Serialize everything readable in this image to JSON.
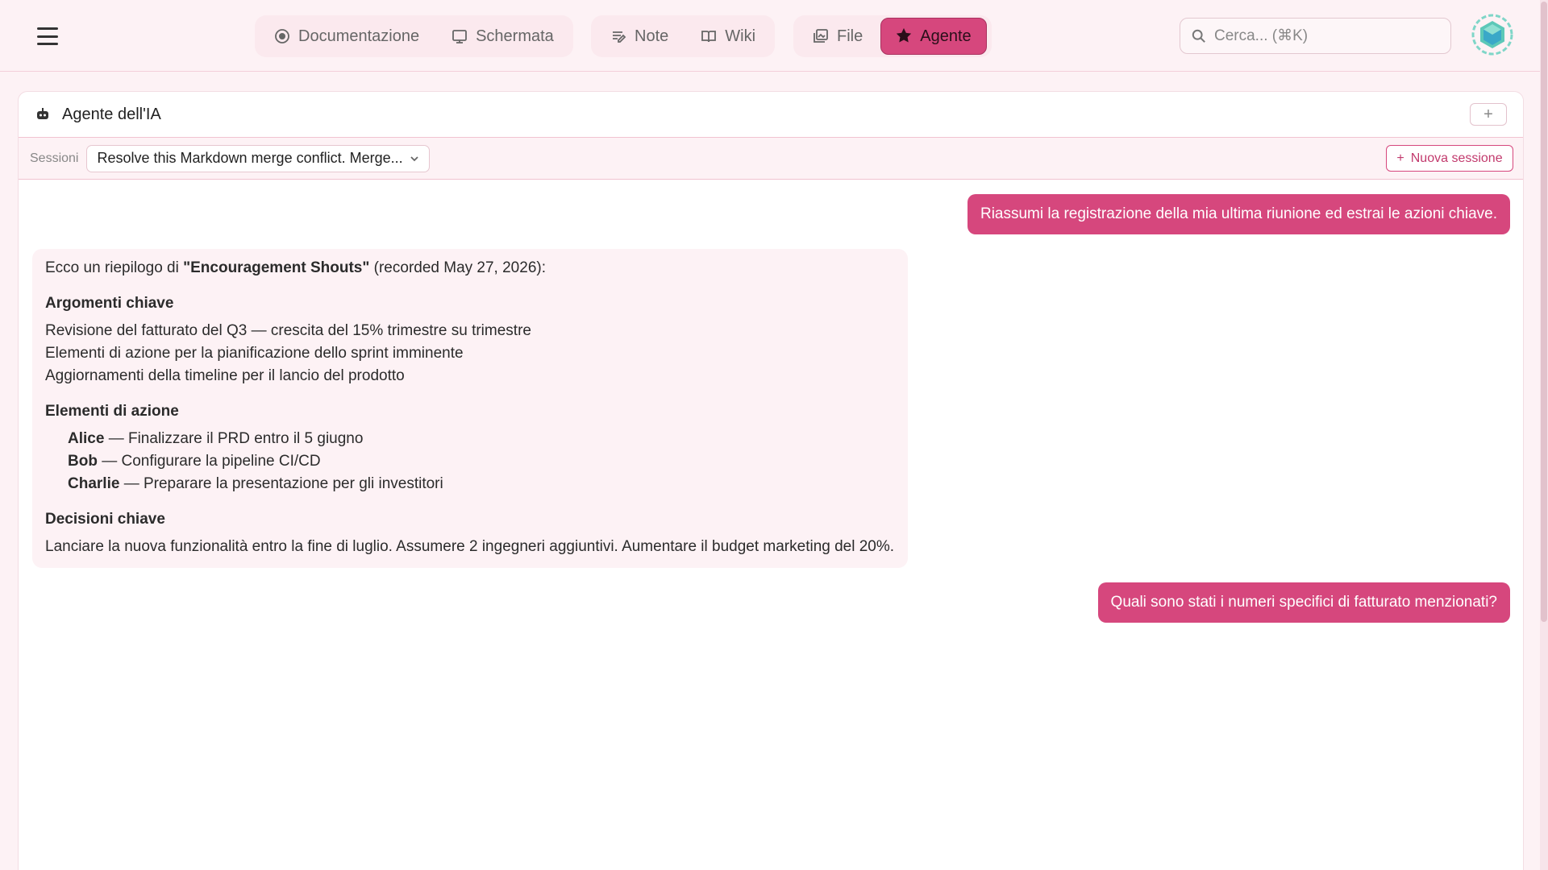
{
  "nav": {
    "groups": [
      [
        {
          "label": "Documentazione",
          "icon": "record-icon",
          "active": false
        },
        {
          "label": "Schermata",
          "icon": "screen-icon",
          "active": false
        }
      ],
      [
        {
          "label": "Note",
          "icon": "notes-icon",
          "active": false
        },
        {
          "label": "Wiki",
          "icon": "book-icon",
          "active": false
        }
      ],
      [
        {
          "label": "File",
          "icon": "files-icon",
          "active": false
        },
        {
          "label": "Agente",
          "icon": "agent-icon",
          "active": true
        }
      ]
    ]
  },
  "search": {
    "placeholder": "Cerca... (⌘K)"
  },
  "panel": {
    "title": "Agente dell'IA",
    "add_label": "+",
    "sessions_label": "Sessioni",
    "selected_session": "Resolve this Markdown merge conflict. Merge...",
    "new_session_label": "Nuova sessione"
  },
  "messages": {
    "user_1": "Riassumi la registrazione della mia ultima riunione ed estrai le azioni chiave.",
    "agent": {
      "intro_prefix": "Ecco un riepilogo di ",
      "intro_title": "\"Encouragement Shouts\"",
      "intro_suffix": " (recorded May 27, 2026):",
      "topics_heading": "Argomenti chiave",
      "topics": [
        "Revisione del fatturato del Q3 — crescita del 15% trimestre su trimestre",
        "Elementi di azione per la pianificazione dello sprint imminente",
        "Aggiornamenti della timeline per il lancio del prodotto"
      ],
      "actions_heading": "Elementi di azione",
      "actions": [
        {
          "name": "Alice",
          "text": " — Finalizzare il PRD entro il 5 giugno"
        },
        {
          "name": "Bob",
          "text": " — Configurare la pipeline CI/CD"
        },
        {
          "name": "Charlie",
          "text": " — Preparare la presentazione per gli investitori"
        }
      ],
      "decisions_heading": "Decisioni chiave",
      "decisions": "Lanciare la nuova funzionalità entro la fine di luglio. Assumere 2 ingegneri aggiuntivi. Aumentare il budget marketing del 20%."
    },
    "user_2": "Quali sono stati i numeri specifici di fatturato menzionati?"
  },
  "colors": {
    "accent": "#d6477d",
    "background": "#fdf2f5",
    "agent_bubble": "#fdf2f5"
  }
}
